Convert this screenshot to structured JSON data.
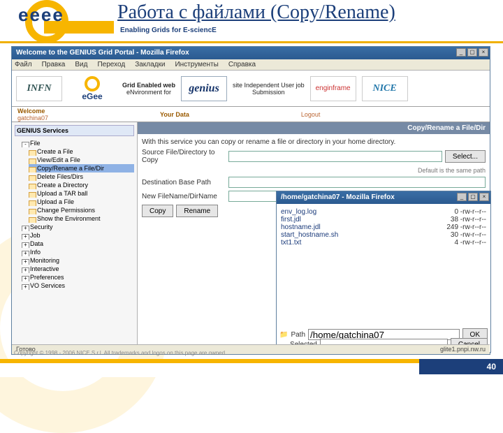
{
  "slide": {
    "title": "Работа с файлами (Copy/Rename)",
    "tagline": "Enabling Grids for E-sciencE",
    "logo_text": "eeee",
    "page_number": "40"
  },
  "browser": {
    "title": "Welcome to the GENIUS Grid Portal - Mozilla Firefox",
    "menus": [
      "Файл",
      "Правка",
      "Вид",
      "Переход",
      "Закладки",
      "Инструменты",
      "Справка"
    ],
    "status_left": "Готово",
    "status_right": "glite1.pnpi.nw.ru"
  },
  "banner": {
    "infn": "INFN",
    "egee_small_top": "eGee",
    "egee_small_sub": "Enabling Grids\nfor E-sciencE",
    "acro1_top": "Grid Enabled web",
    "acro1_bot": "eNvironment for",
    "genius": "genius",
    "acro2_top": "site Independent User job",
    "acro2_bot": "Submission",
    "enginframe": "enginframe",
    "nice": "NICE"
  },
  "welcome": {
    "label": "Welcome",
    "user": "gatchina07",
    "your_data": "Your Data",
    "logout": "Logout"
  },
  "sidebar": {
    "services_title": "GENIUS Services",
    "file_label": "File",
    "items": [
      "Create a File",
      "View/Edit a File",
      "Copy/Rename a File/Dir",
      "Delete Files/Dirs",
      "Create a Directory",
      "Upload a TAR ball",
      "Upload a File",
      "Change Permissions",
      "Show the Environment"
    ],
    "folders": [
      "Security",
      "Job",
      "Data",
      "Info",
      "Monitoring",
      "Interactive",
      "Preferences",
      "VO Services"
    ]
  },
  "panel": {
    "head": "Copy/Rename a File/Dir",
    "intro": "With this service you can copy or rename a file or directory in your home directory.",
    "src_label": "Source File/Directory to Copy",
    "dest_label": "Destination Base Path",
    "new_label": "New FileName/DirName",
    "select_btn": "Select...",
    "hint": "Default is the same path",
    "copy_btn": "Copy",
    "rename_btn": "Rename"
  },
  "popup": {
    "title": "/home/gatchina07 - Mozilla Firefox",
    "files": [
      "env_log.log",
      "first.jdl",
      "hostname.jdl",
      "start_hostname.sh",
      "txt1.txt"
    ],
    "meta": [
      "0 -rw-r--r--",
      "38 -rw-r--r--",
      "249 -rw-r--r--",
      "30 -rw-r--r--",
      "4 -rw-r--r--"
    ],
    "path_label": "Path",
    "path_value": "/home/gatchina07",
    "selected_label": "Selected",
    "ok": "OK",
    "cancel": "Cancel",
    "status": "Готово"
  },
  "copyright": "Copyright © 1998 - 2006 NICE S.r.l. All trademarks and logos on this page are owned..."
}
